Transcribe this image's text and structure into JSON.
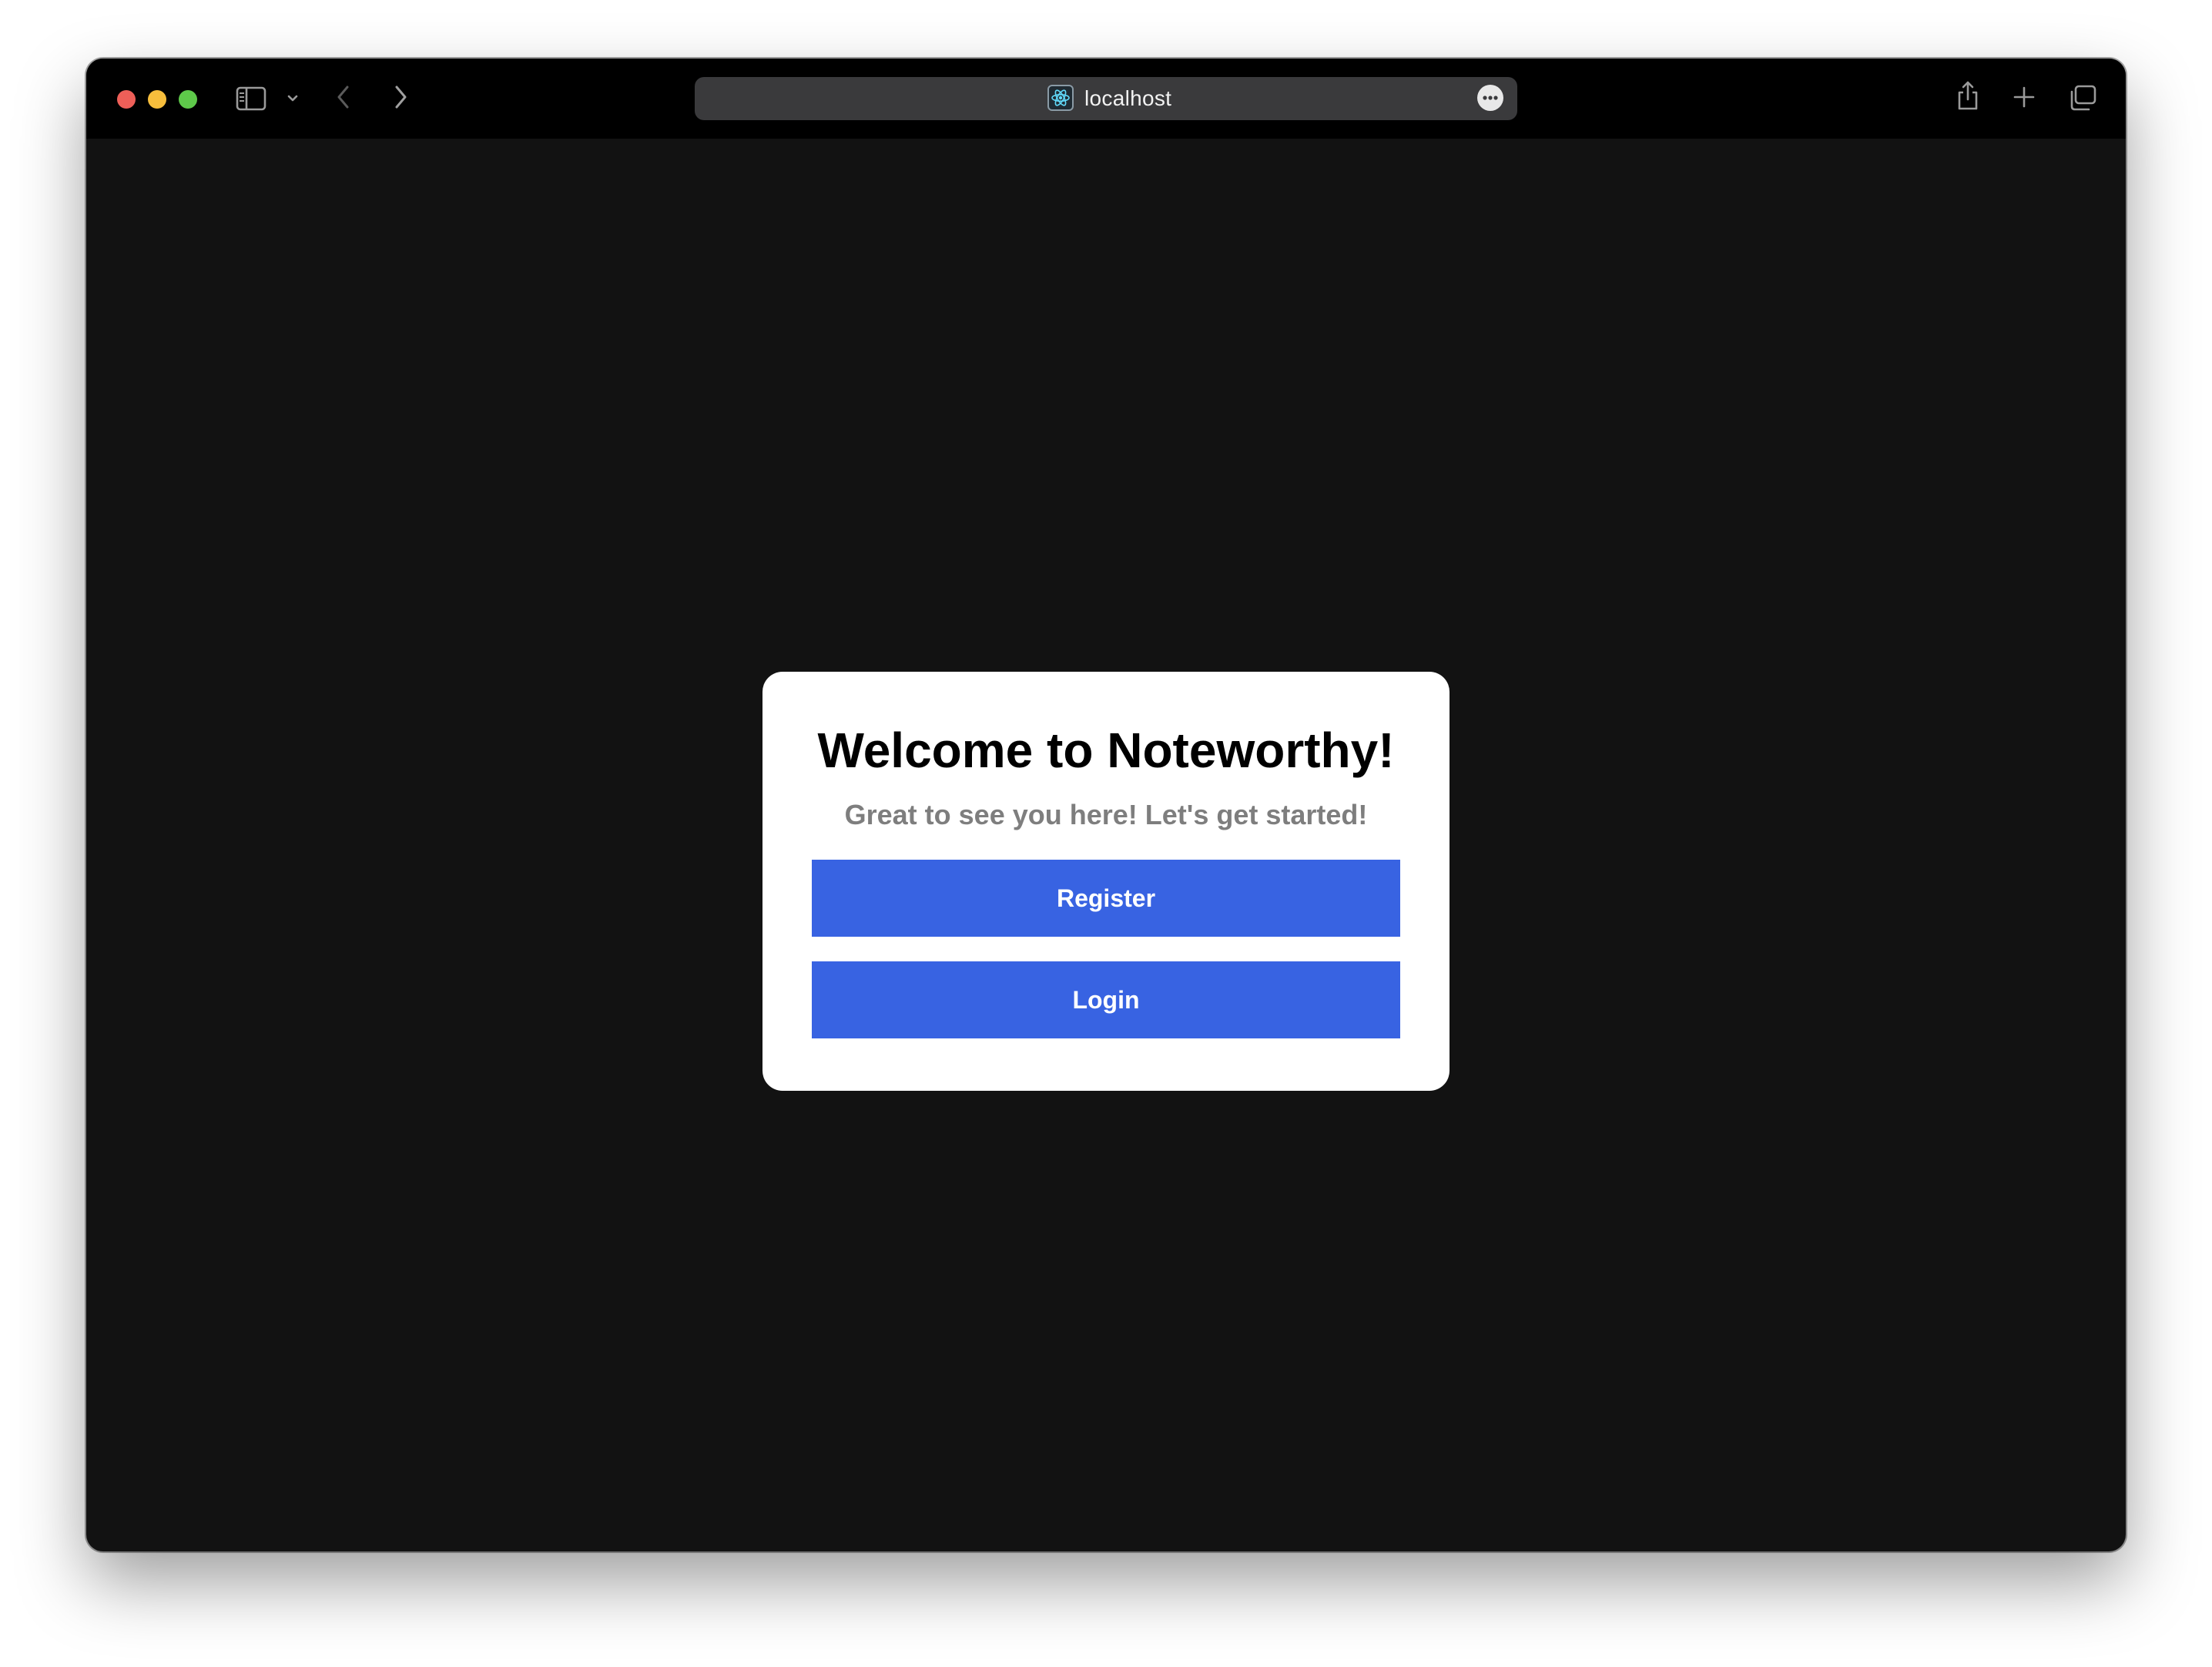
{
  "browser": {
    "url": "localhost",
    "icons": {
      "close": "close-window-icon",
      "minimize": "minimize-window-icon",
      "zoom": "zoom-window-icon",
      "sidebar": "sidebar-icon",
      "sidebar_menu": "chevron-down-icon",
      "back": "chevron-left-icon",
      "forward": "chevron-right-icon",
      "favicon": "react-atom-icon",
      "page_menu": "more-icon",
      "share": "share-icon",
      "new_tab": "plus-icon",
      "tab_overview": "tabs-icon"
    },
    "colors": {
      "titlebar": "#000000",
      "content_background": "#121212",
      "address_bar": "#3a3a3c"
    }
  },
  "welcome": {
    "title": "Welcome to Noteworthy!",
    "subtitle": "Great to see you here! Let's get started!",
    "register_label": "Register",
    "login_label": "Login",
    "colors": {
      "button": "#3863e2",
      "subtitle": "#7e7e7e",
      "card": "#ffffff"
    }
  }
}
